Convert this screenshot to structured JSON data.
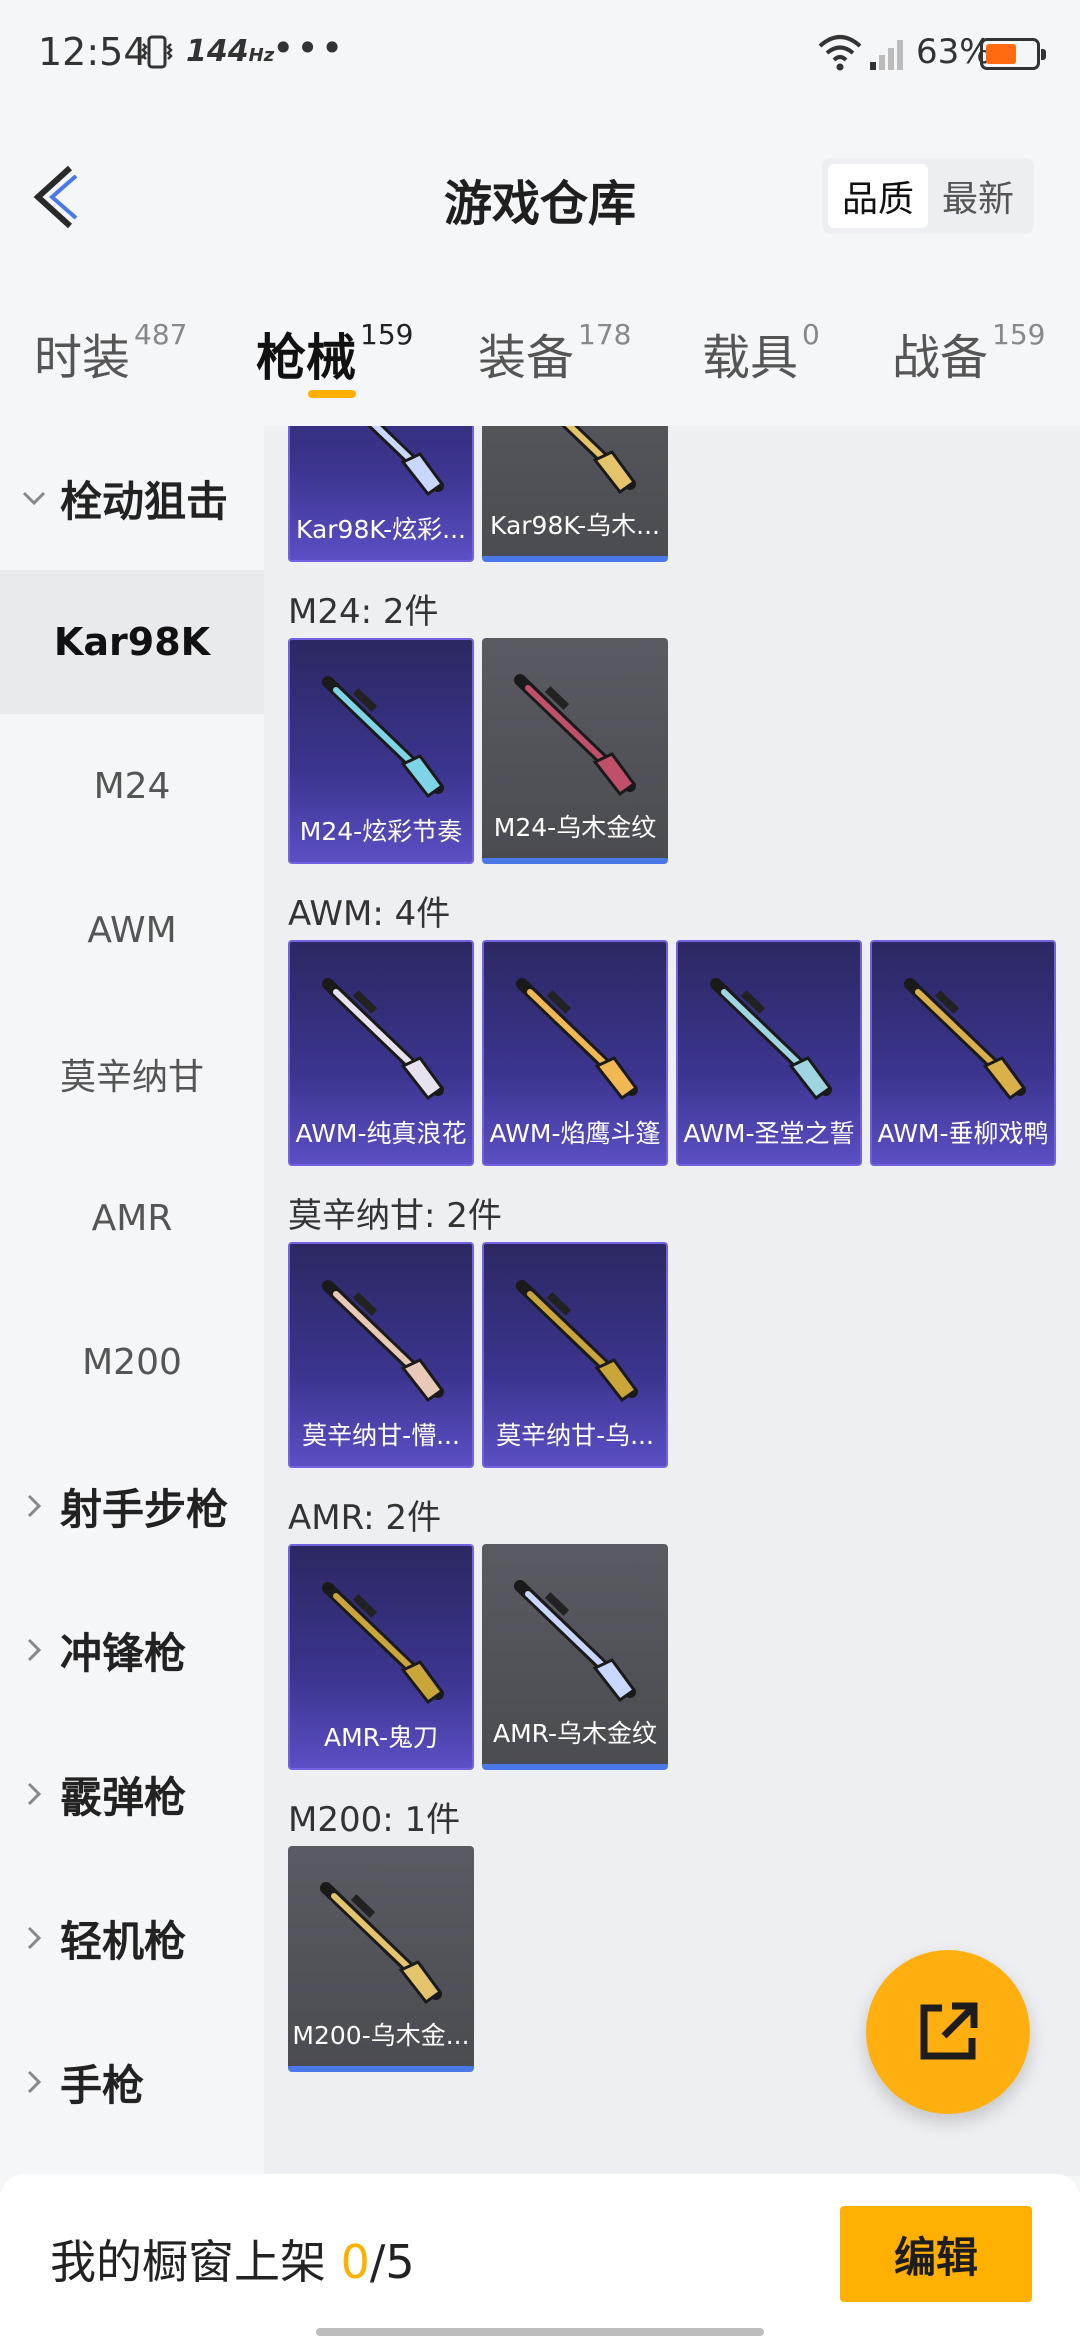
{
  "status": {
    "time": "12:54",
    "refresh_rate": "144",
    "refresh_unit": "Hz",
    "dots": "•••",
    "battery_percent": "63%",
    "battery_level": 0.63
  },
  "header": {
    "title": "游戏仓库",
    "sort_options": [
      "品质",
      "最新"
    ],
    "sort_selected": "品质"
  },
  "tabs": [
    {
      "label": "时装",
      "count": "487"
    },
    {
      "label": "枪械",
      "count": "159",
      "active": true
    },
    {
      "label": "装备",
      "count": "178"
    },
    {
      "label": "载具",
      "count": "0"
    },
    {
      "label": "战备",
      "count": "159"
    }
  ],
  "sidebar": {
    "groups": {
      "sniper": "栓动狙击",
      "dmr": "射手步枪",
      "smg": "冲锋枪",
      "shotgun": "霰弹枪",
      "lmg": "轻机枪",
      "pistol": "手枪"
    },
    "items": [
      "Kar98K",
      "M24",
      "AWM",
      "莫辛纳甘",
      "AMR",
      "M200"
    ],
    "active_item": "Kar98K"
  },
  "sections": [
    {
      "title": "",
      "cards": [
        {
          "name": "Kar98K-炫彩...",
          "rarity": "premium",
          "icon": "rifle-icon"
        },
        {
          "name": "Kar98K-乌木...",
          "rarity": "normal",
          "icon": "rifle-icon"
        }
      ]
    },
    {
      "title": "M24: 2件",
      "cards": [
        {
          "name": "M24-炫彩节奏",
          "rarity": "premium",
          "icon": "rifle-icon"
        },
        {
          "name": "M24-乌木金纹",
          "rarity": "normal",
          "icon": "rifle-icon"
        }
      ]
    },
    {
      "title": "AWM: 4件",
      "cards": [
        {
          "name": "AWM-纯真浪花",
          "rarity": "premium",
          "icon": "sniper-rifle-icon"
        },
        {
          "name": "AWM-焰鹰斗篷",
          "rarity": "premium",
          "icon": "sniper-rifle-icon"
        },
        {
          "name": "AWM-圣堂之誓",
          "rarity": "premium",
          "icon": "sniper-rifle-icon"
        },
        {
          "name": "AWM-垂柳戏鸭",
          "rarity": "premium",
          "icon": "sniper-rifle-icon"
        }
      ]
    },
    {
      "title": "莫辛纳甘: 2件",
      "cards": [
        {
          "name": "莫辛纳甘-懵...",
          "rarity": "premium",
          "icon": "rifle-icon"
        },
        {
          "name": "莫辛纳甘-乌...",
          "rarity": "premium",
          "icon": "rifle-icon"
        }
      ]
    },
    {
      "title": "AMR: 2件",
      "cards": [
        {
          "name": "AMR-鬼刀",
          "rarity": "premium",
          "icon": "sniper-rifle-icon"
        },
        {
          "name": "AMR-乌木金纹",
          "rarity": "normal",
          "icon": "sniper-rifle-icon"
        }
      ]
    },
    {
      "title": "M200: 1件",
      "cards": [
        {
          "name": "M200-乌木金...",
          "rarity": "normal",
          "icon": "sniper-rifle-icon"
        }
      ]
    }
  ],
  "bottom": {
    "shelf_label": "我的橱窗上架",
    "shelf_used": "0",
    "shelf_total": "/5",
    "edit_label": "编辑"
  },
  "colors": {
    "accent": "#ffb000",
    "premium_card": "#3c3590",
    "normal_card": "#4b4b52",
    "normal_card_bar": "#4a78e8",
    "battery": "#ff6a10"
  }
}
